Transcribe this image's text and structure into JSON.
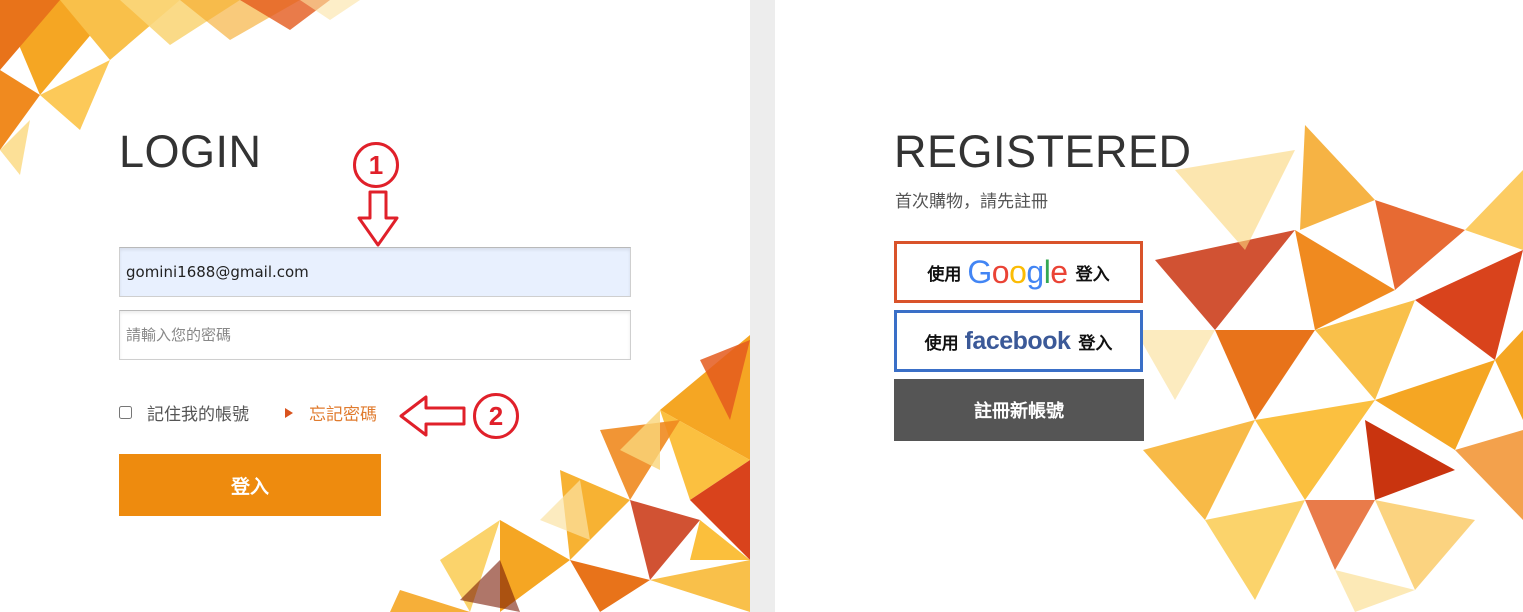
{
  "login": {
    "heading": "LOGIN",
    "email_value": "gomini1688@gmail.com",
    "password_placeholder": "請輸入您的密碼",
    "remember_label": "記住我的帳號",
    "remember_checked": false,
    "forgot_label": "忘記密碼",
    "submit_label": "登入"
  },
  "register": {
    "heading": "REGISTERED",
    "subtitle": "首次購物，請先註冊",
    "google": {
      "prefix": "使用",
      "logo": "Google",
      "suffix": "登入"
    },
    "facebook": {
      "prefix": "使用",
      "logo": "facebook",
      "suffix": "登入"
    },
    "new_account_label": "註冊新帳號"
  },
  "annotations": {
    "step1": "1",
    "step2": "2"
  },
  "colors": {
    "accent_orange": "#ee8b0e",
    "google_border": "#d9532a",
    "facebook_border": "#3a6fc7",
    "register_button": "#555555",
    "annotation_red": "#e0202a"
  }
}
